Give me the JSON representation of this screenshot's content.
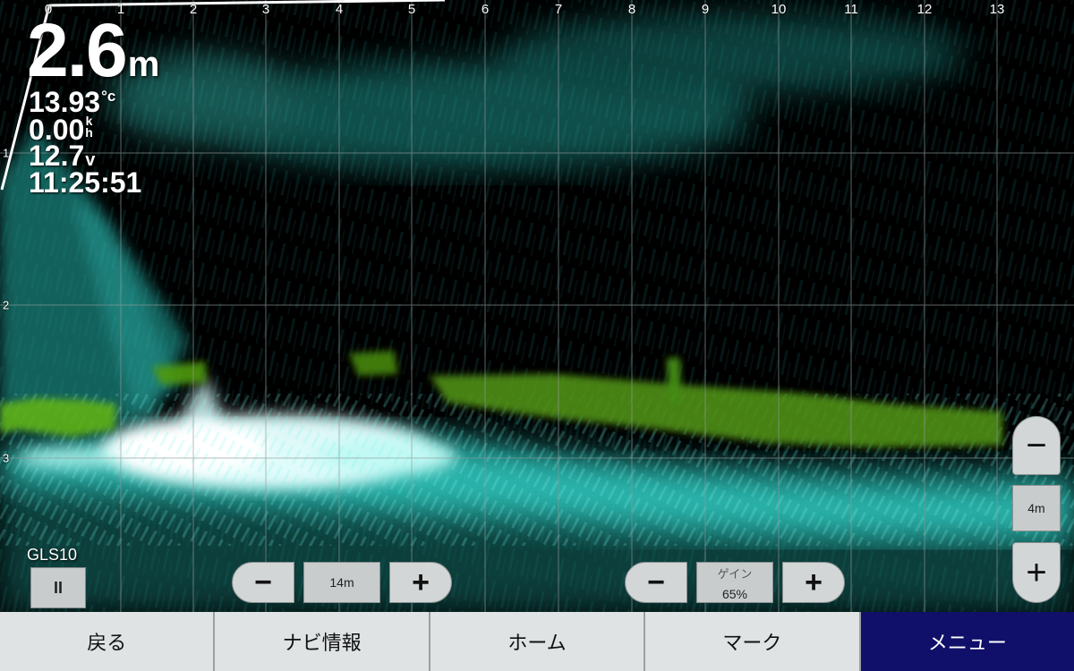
{
  "screen": {
    "horizontal_scale": [
      "0",
      "1",
      "2",
      "3",
      "4",
      "5",
      "6",
      "7",
      "8",
      "9",
      "10",
      "11",
      "12",
      "13"
    ],
    "vertical_scale": [
      "1",
      "2",
      "3"
    ]
  },
  "readouts": {
    "depth_value": "2.6",
    "depth_unit": "m",
    "water_temp_value": "13.93",
    "water_temp_unit": "°c",
    "speed_value": "0.00",
    "speed_unit_top": "k",
    "speed_unit_bottom": "h",
    "voltage_value": "12.7",
    "voltage_unit": "v",
    "time": "11:25:51"
  },
  "source": {
    "label": "GLS10",
    "pause_icon": "pause-icon",
    "pause_symbol": "II"
  },
  "range_control": {
    "value": "14m",
    "minus_symbol": "−",
    "plus_symbol": "+"
  },
  "gain_control": {
    "caption": "ゲイン",
    "value": "65%",
    "minus_symbol": "−",
    "plus_symbol": "+"
  },
  "depth_zoom": {
    "value": "4m",
    "minus_symbol": "−",
    "plus_symbol": "+"
  },
  "softkeys": [
    {
      "label": "戻る",
      "active": false
    },
    {
      "label": "ナビ情報",
      "active": false
    },
    {
      "label": "ホーム",
      "active": false
    },
    {
      "label": "マーク",
      "active": false
    },
    {
      "label": "メニュー",
      "active": true
    }
  ],
  "colors": {
    "sonar_cyan": "#3fd6cc",
    "sonar_white": "#f4ffff",
    "vegetation_green": "#5fa80f",
    "softkey_bg": "#dfe3e3",
    "softkey_active": "#10106a"
  }
}
